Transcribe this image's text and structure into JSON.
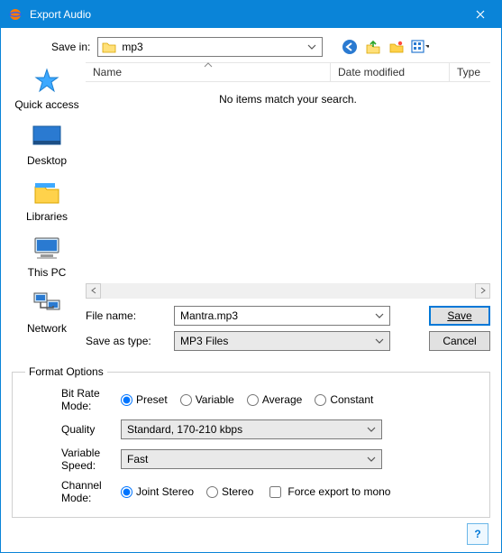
{
  "window": {
    "title": "Export Audio"
  },
  "topbar": {
    "save_in_label": "Save in:",
    "folder_name": "mp3"
  },
  "places": {
    "quick_access": "Quick access",
    "desktop": "Desktop",
    "libraries": "Libraries",
    "this_pc": "This PC",
    "network": "Network"
  },
  "list": {
    "col_name": "Name",
    "col_date": "Date modified",
    "col_type": "Type",
    "empty_msg": "No items match your search."
  },
  "file": {
    "name_label": "File name:",
    "name_value": "Mantra.mp3",
    "type_label": "Save as type:",
    "type_value": "MP3 Files",
    "save_btn": "Save",
    "cancel_btn": "Cancel"
  },
  "format": {
    "legend": "Format Options",
    "bit_rate_label": "Bit Rate Mode:",
    "bit_rate_options": {
      "preset": "Preset",
      "variable": "Variable",
      "average": "Average",
      "constant": "Constant"
    },
    "quality_label": "Quality",
    "quality_value": "Standard, 170-210 kbps",
    "vspeed_label": "Variable Speed:",
    "vspeed_value": "Fast",
    "channel_label": "Channel Mode:",
    "channel_options": {
      "joint": "Joint Stereo",
      "stereo": "Stereo"
    },
    "force_mono": "Force export to mono"
  },
  "help": {
    "glyph": "?"
  }
}
